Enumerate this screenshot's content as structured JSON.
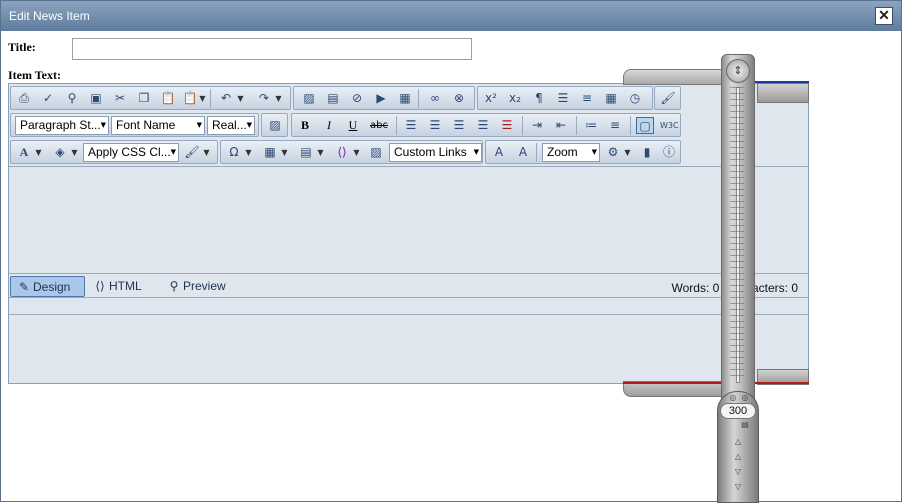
{
  "dialog": {
    "title": "Edit News Item",
    "close_glyph": "✕"
  },
  "form": {
    "title_label": "Title:",
    "title_value": "",
    "item_text_label": "Item Text:"
  },
  "toolbar": {
    "row1_icons": [
      "print-icon",
      "spellcheck-icon",
      "find-icon",
      "select-all-icon",
      "cut-icon",
      "copy-icon",
      "paste-icon",
      "paste-options-icon",
      "undo-icon",
      "redo-icon",
      "image-manager-icon",
      "document-manager-icon",
      "flash-manager-icon",
      "media-manager-icon",
      "template-manager-icon",
      "link-icon",
      "unlink-icon",
      "superscript-icon",
      "subscript-icon",
      "paragraph-icon",
      "horizontal-rule-icon",
      "insert-date-icon",
      "insert-symbol-line-icon",
      "insert-time-icon",
      "format-stripper-icon"
    ],
    "paragraph_style": "Paragraph St...",
    "font_name": "Font Name",
    "font_size": "Real...",
    "apply_css": "Apply CSS Cl...",
    "custom_links": "Custom Links",
    "zoom": "Zoom",
    "bold": "B",
    "italic": "I",
    "underline": "U",
    "strikethrough": "abc"
  },
  "modes": {
    "design": "Design",
    "html": "HTML",
    "preview": "Preview"
  },
  "stats": {
    "words": "Words: 0",
    "characters": "Characters: 0"
  },
  "ruler": {
    "value": "300"
  }
}
